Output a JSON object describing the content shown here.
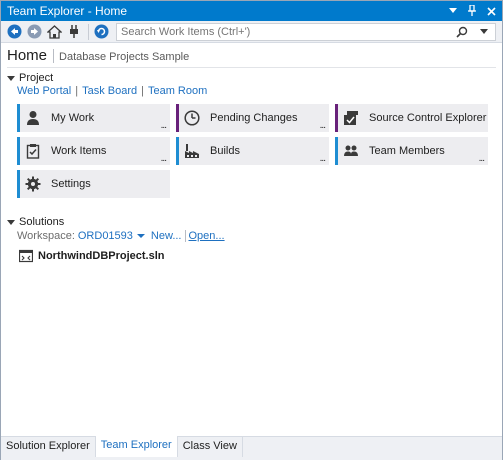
{
  "window": {
    "title": "Team Explorer - Home",
    "pin_glyph": "▾ ⊓",
    "close_glyph": "✕"
  },
  "toolbar": {
    "search_placeholder": "Search Work Items (Ctrl+')"
  },
  "header": {
    "title": "Home",
    "subtitle": "Database Projects Sample"
  },
  "project": {
    "heading": "Project",
    "links": [
      "Web Portal",
      "Task Board",
      "Team Room"
    ],
    "tiles": [
      {
        "label": "My Work",
        "icon": "person-icon",
        "accent": "#1e8dd2",
        "more": true
      },
      {
        "label": "Pending Changes",
        "icon": "clock-icon",
        "accent": "#68217a",
        "more": true
      },
      {
        "label": "Source Control Explorer",
        "icon": "source-control-icon",
        "accent": "#68217a",
        "more": false
      },
      {
        "label": "Work Items",
        "icon": "clipboard-check-icon",
        "accent": "#1e8dd2",
        "more": true
      },
      {
        "label": "Builds",
        "icon": "factory-icon",
        "accent": "#1e8dd2",
        "more": true
      },
      {
        "label": "Team Members",
        "icon": "team-icon",
        "accent": "#1e8dd2",
        "more": true
      },
      {
        "label": "Settings",
        "icon": "gear-icon",
        "accent": "#1e8dd2",
        "more": false
      }
    ],
    "more_glyph": "..."
  },
  "solutions": {
    "heading": "Solutions",
    "workspace_label": "Workspace:",
    "workspace_value": "ORD01593",
    "new_link": "New...",
    "open_link": "Open...",
    "items": [
      "NorthwindDBProject.sln"
    ]
  },
  "bottom_tabs": [
    "Solution Explorer",
    "Team Explorer",
    "Class View"
  ],
  "active_tab": "Team Explorer",
  "colors": {
    "title_bar": "#007acc",
    "link": "#1e70c0",
    "accent_blue": "#1e8dd2",
    "accent_purple": "#68217a"
  }
}
